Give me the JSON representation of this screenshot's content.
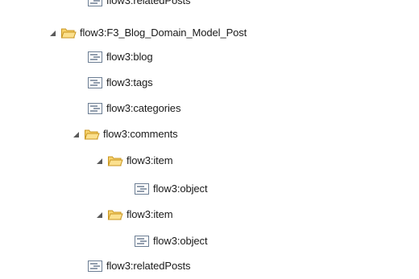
{
  "tree": {
    "nodes": [
      {
        "label": "flow3:relatedPosts",
        "type": "leaf",
        "depth": 2,
        "expanded": null,
        "partially_visible": true
      },
      {
        "label": "flow3:F3_Blog_Domain_Model_Post",
        "type": "folder",
        "depth": 1,
        "expanded": true
      },
      {
        "label": "flow3:blog",
        "type": "leaf",
        "depth": 2,
        "expanded": null
      },
      {
        "label": "flow3:tags",
        "type": "leaf",
        "depth": 2,
        "expanded": null
      },
      {
        "label": "flow3:categories",
        "type": "leaf",
        "depth": 2,
        "expanded": null
      },
      {
        "label": "flow3:comments",
        "type": "folder",
        "depth": 2,
        "expanded": true
      },
      {
        "label": "flow3:item",
        "type": "folder",
        "depth": 3,
        "expanded": true
      },
      {
        "label": "flow3:object",
        "type": "leaf",
        "depth": 4,
        "expanded": null
      },
      {
        "label": "flow3:item",
        "type": "folder",
        "depth": 3,
        "expanded": true
      },
      {
        "label": "flow3:object",
        "type": "leaf",
        "depth": 4,
        "expanded": null
      },
      {
        "label": "flow3:relatedPosts",
        "type": "leaf",
        "depth": 2,
        "expanded": null
      }
    ]
  },
  "icons": {
    "folder": "folder-open-icon",
    "leaf": "text-node-icon",
    "toggle": "expand-triangle-icon"
  },
  "colors": {
    "folder_fill": "#f7d36e",
    "folder_stroke": "#c8951f",
    "leaf_fill": "#ffffff",
    "leaf_stroke": "#6b7d93",
    "leaf_lines": "#4a5d78",
    "toggle": "#5a5a5a",
    "text": "#1a1a1a"
  }
}
